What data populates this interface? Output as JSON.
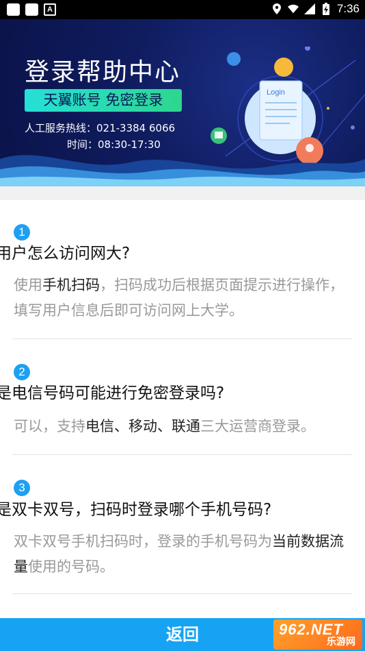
{
  "status_bar": {
    "time": "7:36",
    "battery_icon": "battery-charging-icon"
  },
  "banner": {
    "title": "登录帮助中心",
    "pill": "天翼账号  免密登录",
    "hotline": "人工服务热线：021-3384 6066",
    "hours": "时间：08:30-17:30",
    "illustration_label": "Login"
  },
  "faqs": [
    {
      "number": "1",
      "question": "用户怎么访问网大?",
      "answer": [
        {
          "t": "使用",
          "hl": false
        },
        {
          "t": "手机扫码",
          "hl": true
        },
        {
          "t": "，扫码成功后根据页面提示进行操作，填写用户信息后即可访问网上大学。",
          "hl": false
        }
      ]
    },
    {
      "number": "2",
      "question": "是电信号码可能进行免密登录吗?",
      "answer": [
        {
          "t": "可以，支持",
          "hl": false
        },
        {
          "t": "电信、移动、联通",
          "hl": true
        },
        {
          "t": "三大运营商登录。",
          "hl": false
        }
      ]
    },
    {
      "number": "3",
      "question": "是双卡双号，扫码时登录哪个手机号码?",
      "answer": [
        {
          "t": "双卡双号手机扫码时，登录的手机号码为",
          "hl": false
        },
        {
          "t": "当前数据流量",
          "hl": true
        },
        {
          "t": "使用的号码。",
          "hl": false
        }
      ]
    }
  ],
  "footer": {
    "back_label": "返回"
  },
  "watermark": {
    "top": "962.NET",
    "bottom": "乐游网"
  },
  "colors": {
    "accent": "#17a3f3",
    "badge": "#1ea0f2",
    "banner_bg": "#0f1c5f",
    "pill_start": "#25e0d6",
    "pill_end": "#2ed68f"
  }
}
